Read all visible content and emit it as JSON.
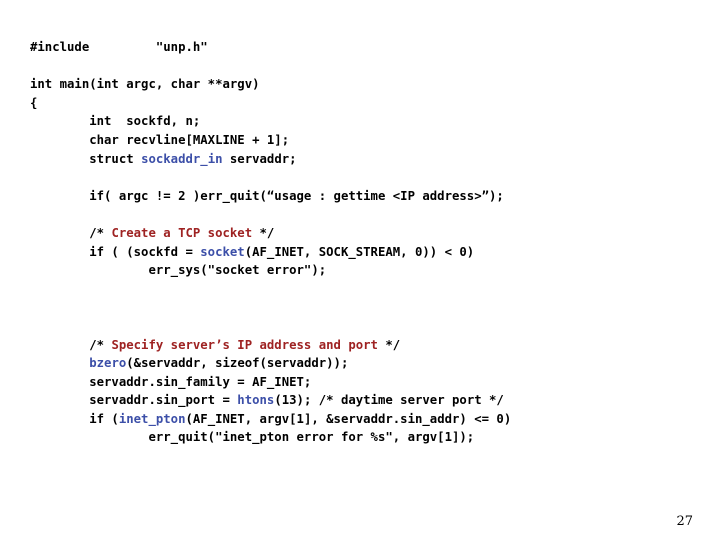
{
  "slide": {
    "page_number": "27",
    "colors": {
      "background": "#ffffff",
      "text": "#000000",
      "function_blue": "#3c4fa8",
      "comment_red": "#9e2222"
    },
    "code_lines": [
      {
        "id": "line-include",
        "segments": [
          {
            "text": "#include",
            "color": "plain"
          },
          {
            "text": "         ",
            "color": "plain"
          },
          {
            "text": "\"unp.h\"",
            "color": "plain"
          }
        ]
      },
      {
        "id": "line-blank-1",
        "blank": true,
        "segments": []
      },
      {
        "id": "line-main",
        "segments": [
          {
            "text": "int main(int argc, char **argv)",
            "color": "plain"
          }
        ]
      },
      {
        "id": "line-open-brace",
        "segments": [
          {
            "text": "{",
            "color": "plain"
          }
        ]
      },
      {
        "id": "line-decl-int",
        "segments": [
          {
            "text": "        int  sockfd, n;",
            "color": "plain"
          }
        ]
      },
      {
        "id": "line-decl-char",
        "segments": [
          {
            "text": "        char recvline[MAXLINE + 1];",
            "color": "plain"
          }
        ]
      },
      {
        "id": "line-decl-struct",
        "segments": [
          {
            "text": "        struct ",
            "color": "plain"
          },
          {
            "text": "sockaddr_in",
            "color": "fn"
          },
          {
            "text": " servaddr;",
            "color": "plain"
          }
        ]
      },
      {
        "id": "line-blank-2",
        "blank": true,
        "segments": []
      },
      {
        "id": "line-argc-check",
        "segments": [
          {
            "text": "        if( argc != 2 )err_quit(“usage : gettime <IP address>”);",
            "color": "plain"
          }
        ]
      },
      {
        "id": "line-blank-3",
        "blank": true,
        "segments": []
      },
      {
        "id": "line-comment-tcp",
        "segments": [
          {
            "text": "        /* ",
            "color": "plain"
          },
          {
            "text": "Create a TCP socket",
            "color": "comment"
          },
          {
            "text": " */",
            "color": "plain"
          }
        ]
      },
      {
        "id": "line-socket-call",
        "segments": [
          {
            "text": "        if ( (sockfd = ",
            "color": "plain"
          },
          {
            "text": "socket",
            "color": "fn"
          },
          {
            "text": "(AF_INET, SOCK_STREAM, 0)) < 0)",
            "color": "plain"
          }
        ]
      },
      {
        "id": "line-err-sys",
        "segments": [
          {
            "text": "                err_sys(\"socket error\");",
            "color": "plain"
          }
        ]
      },
      {
        "id": "line-blank-4",
        "blank": true,
        "segments": []
      },
      {
        "id": "line-blank-5",
        "blank": true,
        "segments": []
      },
      {
        "id": "line-blank-6",
        "blank": true,
        "segments": []
      },
      {
        "id": "line-comment-specify",
        "segments": [
          {
            "text": "        /* ",
            "color": "plain"
          },
          {
            "text": "Specify server’s IP address and port",
            "color": "comment"
          },
          {
            "text": " */",
            "color": "plain"
          }
        ]
      },
      {
        "id": "line-bzero",
        "segments": [
          {
            "text": "        ",
            "color": "plain"
          },
          {
            "text": "bzero",
            "color": "fn"
          },
          {
            "text": "(&servaddr, sizeof(servaddr));",
            "color": "plain"
          }
        ]
      },
      {
        "id": "line-sin-family",
        "segments": [
          {
            "text": "        servaddr.sin_family = AF_INET;",
            "color": "plain"
          }
        ]
      },
      {
        "id": "line-sin-port",
        "segments": [
          {
            "text": "        servaddr.sin_port = ",
            "color": "plain"
          },
          {
            "text": "htons",
            "color": "fn"
          },
          {
            "text": "(13); /* daytime server port */",
            "color": "plain"
          }
        ]
      },
      {
        "id": "line-inet-pton",
        "segments": [
          {
            "text": "        if (",
            "color": "plain"
          },
          {
            "text": "inet_pton",
            "color": "fn"
          },
          {
            "text": "(AF_INET, argv[1], &servaddr.sin_addr) <= 0)",
            "color": "plain"
          }
        ]
      },
      {
        "id": "line-err-quit",
        "segments": [
          {
            "text": "                err_quit(\"inet_pton error for %s\", argv[1]);",
            "color": "plain"
          }
        ]
      }
    ]
  }
}
